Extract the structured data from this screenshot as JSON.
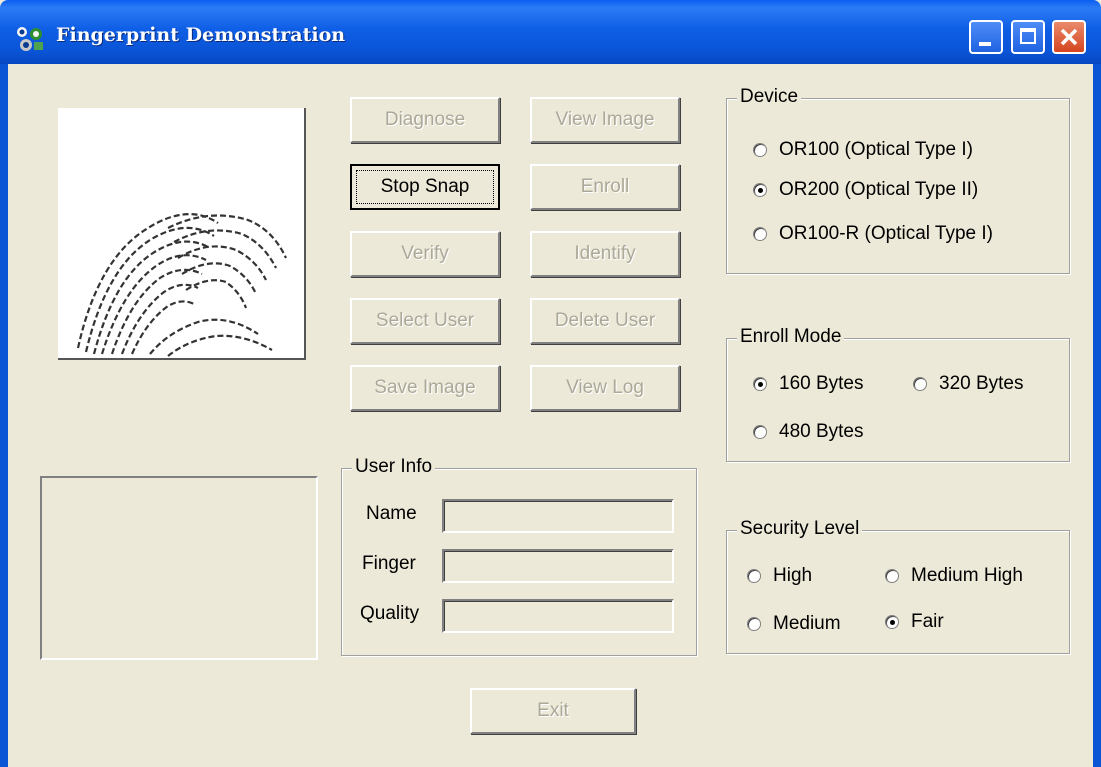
{
  "window": {
    "title": "Fingerprint Demonstration"
  },
  "buttons": {
    "diagnose": "Diagnose",
    "view_image": "View Image",
    "stop_snap": "Stop Snap",
    "enroll": "Enroll",
    "verify": "Verify",
    "identify": "Identify",
    "select_user": "Select User",
    "delete_user": "Delete User",
    "save_image": "Save Image",
    "view_log": "View Log",
    "exit": "Exit"
  },
  "device": {
    "label": "Device",
    "options": [
      "OR100 (Optical Type I)",
      "OR200 (Optical Type II)",
      "OR100-R (Optical Type I)"
    ],
    "selected": "OR200 (Optical Type II)"
  },
  "enroll_mode": {
    "label": "Enroll Mode",
    "options": [
      "160 Bytes",
      "320 Bytes",
      "480 Bytes"
    ],
    "selected": "160 Bytes"
  },
  "security_level": {
    "label": "Security Level",
    "options": [
      "High",
      "Medium High",
      "Medium",
      "Fair"
    ],
    "selected": "Fair"
  },
  "user_info": {
    "label": "User Info",
    "name_label": "Name",
    "finger_label": "Finger",
    "quality_label": "Quality",
    "name_value": "",
    "finger_value": "",
    "quality_value": ""
  }
}
